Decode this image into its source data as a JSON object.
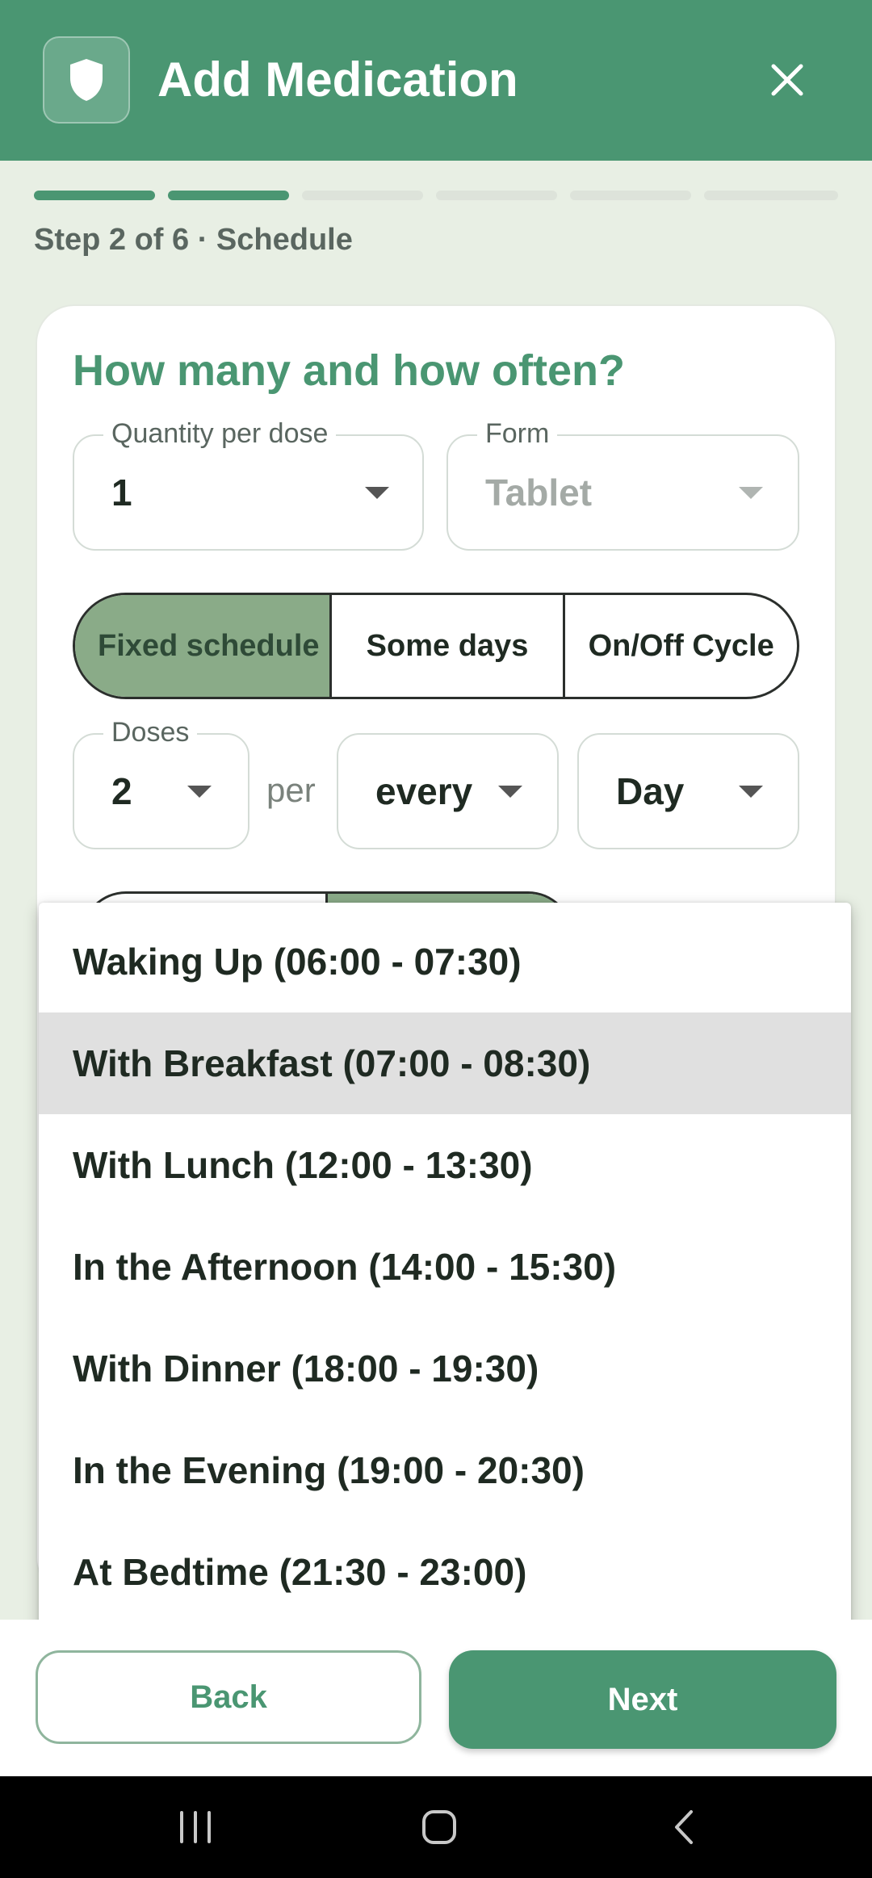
{
  "header": {
    "title": "Add Medication",
    "app_icon": "shield-icon",
    "close_icon": "close-icon",
    "color": "#4a9672"
  },
  "progress": {
    "total_steps": 6,
    "current_step": 2,
    "label": "Step 2 of 6 · Schedule"
  },
  "card": {
    "title": "How many and how often?",
    "quantity": {
      "label": "Quantity per dose",
      "value": "1"
    },
    "form": {
      "label": "Form",
      "value": "Tablet",
      "disabled": true
    },
    "schedule_type": {
      "options": [
        "Fixed schedule",
        "Some days",
        "On/Off Cycle"
      ],
      "selected": "Fixed schedule"
    },
    "doses": {
      "label": "Doses",
      "value": "2"
    },
    "per_label": "per",
    "frequency": {
      "value": "every"
    },
    "period": {
      "value": "Day"
    }
  },
  "dropdown": {
    "items": [
      "Waking Up (06:00 - 07:30)",
      "With Breakfast (07:00 - 08:30)",
      "With Lunch (12:00 - 13:30)",
      "In the Afternoon (14:00 - 15:30)",
      "With Dinner (18:00 - 19:30)",
      "In the Evening (19:00 - 20:30)",
      "At Bedtime (21:30 - 23:00)"
    ],
    "highlighted": "With Breakfast (07:00 - 08:30)"
  },
  "footer": {
    "back_label": "Back",
    "next_label": "Next"
  },
  "system_nav": {
    "recents_icon": "recents-icon",
    "home_icon": "home-icon",
    "back_icon": "back-chevron-icon"
  },
  "colors": {
    "accent": "#4a9672",
    "selected_segment": "#8aab88",
    "background": "#e8efe4"
  }
}
